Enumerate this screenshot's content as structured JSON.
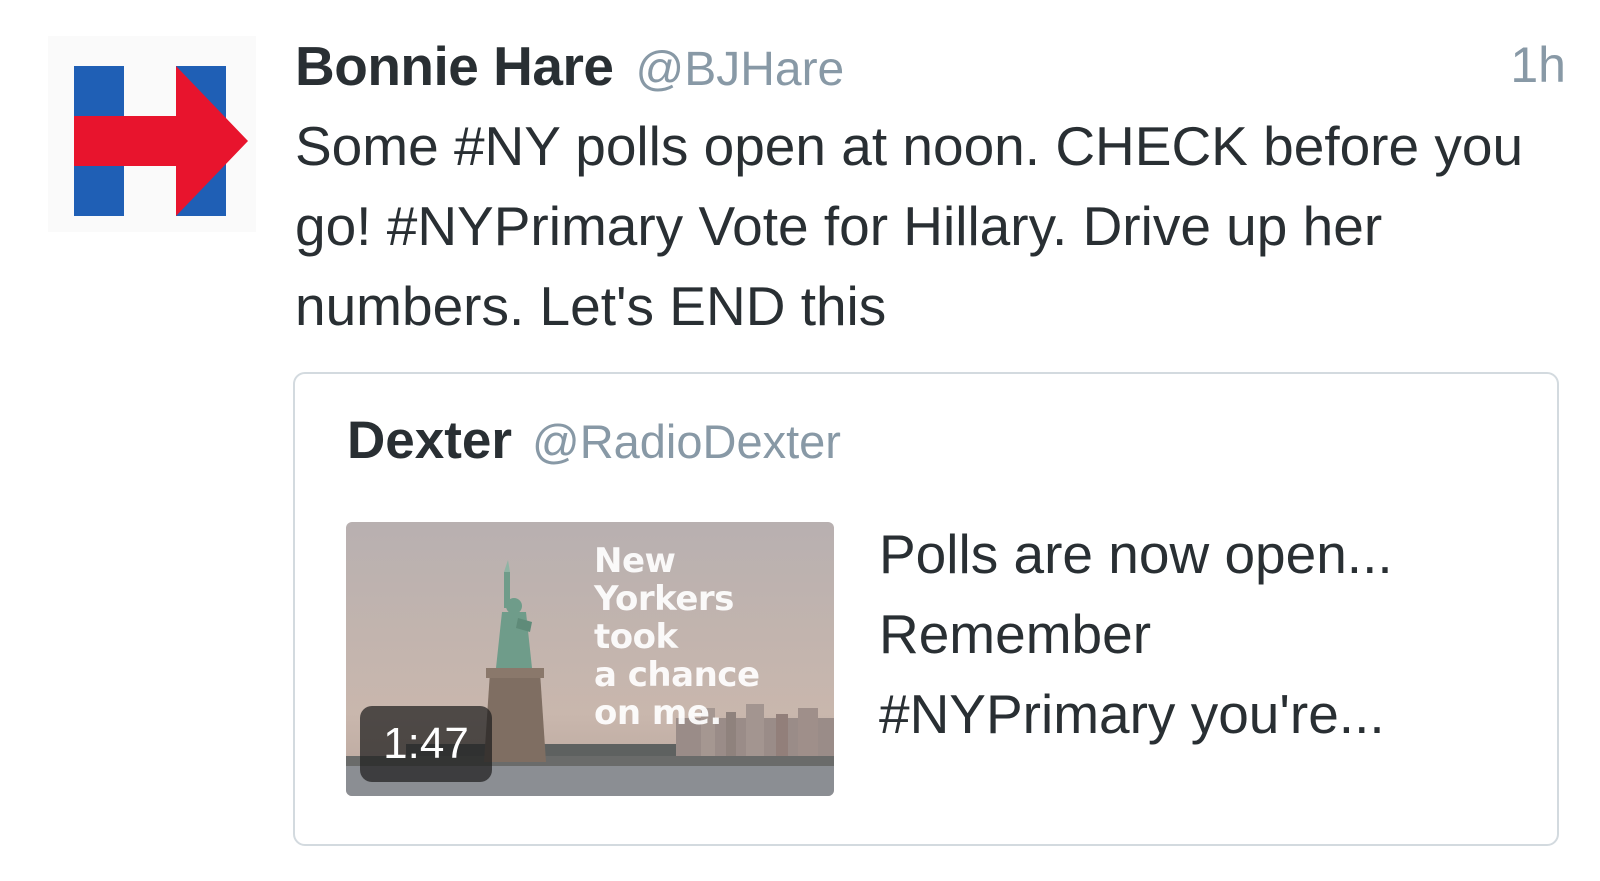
{
  "tweet": {
    "author_name": "Bonnie Hare",
    "author_handle": "@BJHare",
    "timestamp": "1h",
    "text": "Some #NY polls open at noon. CHECK before you go! #NYPrimary Vote for Hillary. Drive up her numbers. Let's END this",
    "avatar_icon": "hillary-h-logo-icon",
    "avatar_colors": {
      "blue": "#1f5fb5",
      "red": "#e8142d"
    }
  },
  "quote": {
    "author_name": "Dexter",
    "author_handle": "@RadioDexter",
    "media": {
      "caption_lines": [
        "New",
        "Yorkers",
        "took",
        "a chance",
        "on me."
      ],
      "duration": "1:47"
    },
    "text_lines": [
      "Polls are now open...",
      "Remember",
      "#NYPrimary you're..."
    ]
  }
}
